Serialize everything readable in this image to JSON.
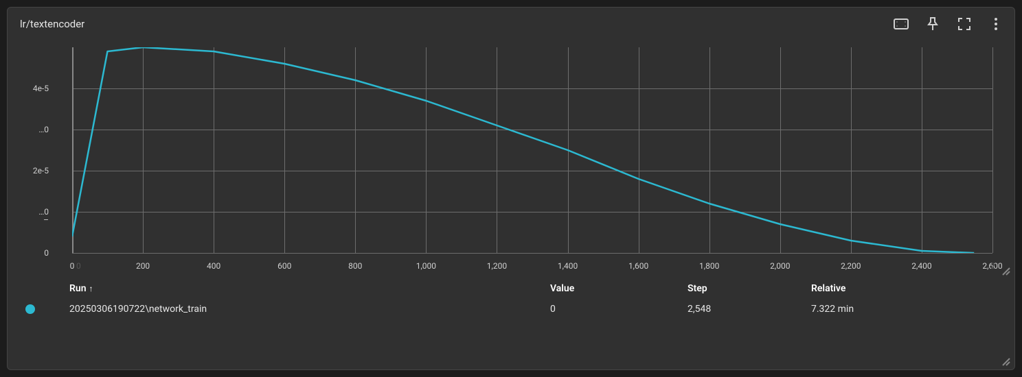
{
  "title": "lr/textencoder",
  "chart_data": {
    "type": "line",
    "xlabel": "",
    "ylabel": "",
    "xlim": [
      0,
      2600
    ],
    "ylim": [
      0,
      5e-05
    ],
    "x_ticks": [
      0,
      200,
      400,
      600,
      800,
      1000,
      1200,
      1400,
      1600,
      1800,
      2000,
      2200,
      2400,
      2600
    ],
    "x_tick_labels": [
      "0",
      "200",
      "400",
      "600",
      "800",
      "1,000",
      "1,200",
      "1,400",
      "1,600",
      "1,800",
      "2,000",
      "2,200",
      "2,400",
      "2,600"
    ],
    "y_ticks": [
      0,
      1e-05,
      2e-05,
      3e-05,
      4e-05
    ],
    "y_tick_labels": [
      "0",
      "…0",
      "2e-5",
      "…0",
      "4e-5"
    ],
    "series": [
      {
        "name": "20250306190722\\network_train",
        "color": "#2cb9d1",
        "x": [
          0,
          100,
          200,
          400,
          600,
          800,
          1000,
          1200,
          1400,
          1600,
          1800,
          2000,
          2200,
          2400,
          2548
        ],
        "values": [
          4e-06,
          4.9e-05,
          5e-05,
          4.9e-05,
          4.6e-05,
          4.2e-05,
          3.7e-05,
          3.1e-05,
          2.5e-05,
          1.8e-05,
          1.2e-05,
          7e-06,
          3e-06,
          5e-07,
          0
        ]
      }
    ]
  },
  "table": {
    "headers": {
      "run": "Run",
      "value": "Value",
      "step": "Step",
      "relative": "Relative",
      "sort_arrow": "↑"
    },
    "rows": [
      {
        "color": "#2cb9d1",
        "run": "20250306190722\\network_train",
        "value": "0",
        "step": "2,548",
        "relative": "7.322 min"
      }
    ]
  }
}
